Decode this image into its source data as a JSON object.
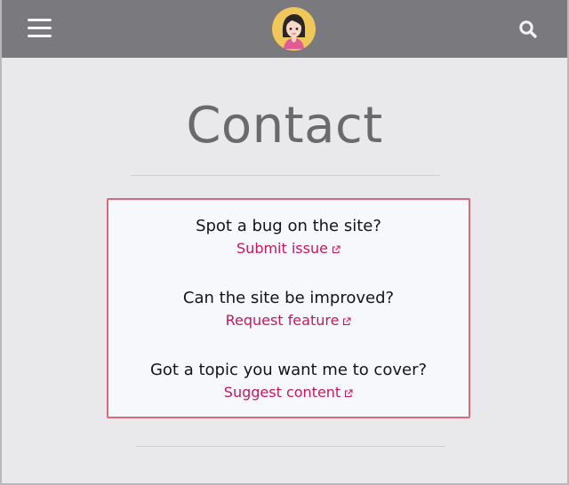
{
  "header": {
    "menu_icon": "hamburger-menu-icon",
    "avatar_icon": "avatar-illustration",
    "search_icon": "search-icon"
  },
  "page": {
    "title": "Contact"
  },
  "contact_items": [
    {
      "question": "Spot a bug on the site?",
      "link_label": "Submit issue",
      "link_icon": "external-link-icon"
    },
    {
      "question": "Can the site be improved?",
      "link_label": "Request feature",
      "link_icon": "external-link-icon"
    },
    {
      "question": "Got a topic you want me to cover?",
      "link_label": "Suggest content",
      "link_icon": "external-link-icon"
    }
  ],
  "colors": {
    "header_bg": "#7a797e",
    "page_bg": "#e9e8eb",
    "card_border": "#d96a7c",
    "link": "#c8175d",
    "avatar_ring": "#f0c75a"
  }
}
